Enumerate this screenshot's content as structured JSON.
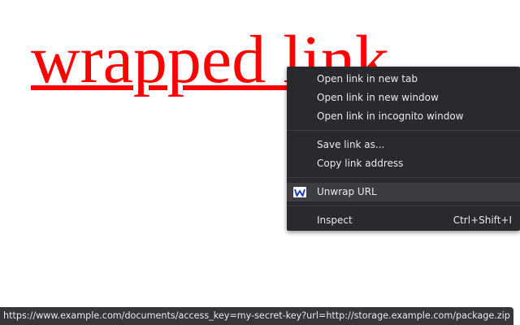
{
  "page": {
    "link_text": "wrapped link",
    "link_color": "#ff0000"
  },
  "context_menu": {
    "items": [
      {
        "label": "Open link in new tab"
      },
      {
        "label": "Open link in new window"
      },
      {
        "label": "Open link in incognito window"
      },
      {
        "label": "Save link as..."
      },
      {
        "label": "Copy link address"
      },
      {
        "label": "Unwrap URL",
        "icon": "extension-w-icon",
        "highlighted": true
      },
      {
        "label": "Inspect",
        "shortcut": "Ctrl+Shift+I"
      }
    ],
    "background": "#292a2d",
    "highlight_color": "#3c3d40"
  },
  "status_bar": {
    "url": "https://www.example.com/documents/access_key=my-secret-key?url=http://storage.example.com/package.zip"
  }
}
